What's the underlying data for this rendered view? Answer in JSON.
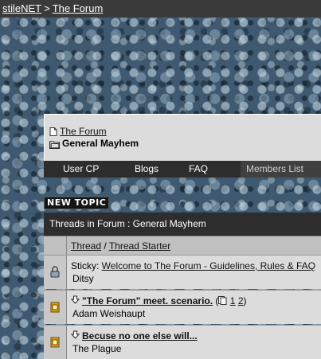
{
  "breadcrumb": {
    "site": "stileNET",
    "separator": ">",
    "current": "The Forum"
  },
  "nav": {
    "forum_link": "The Forum",
    "subforum": "General Mayhem"
  },
  "menu": {
    "items": [
      "User CP",
      "Blogs",
      "FAQ",
      "Members List"
    ]
  },
  "new_topic_label": "NEW TOPIC",
  "threads_header": "Threads in Forum : General Mayhem",
  "columns": {
    "thread": "Thread",
    "separator": " / ",
    "starter": "Thread Starter"
  },
  "threads": [
    {
      "prefix": "Sticky: ",
      "title": "Welcome to The Forum - Guidelines, Rules & FAQ",
      "starter": "Ditsy",
      "icon": "lock-icon"
    },
    {
      "title": "\"The Forum\" meet. scenario.",
      "pages_open": " (",
      "page1": "1",
      "page2": "2",
      "pages_close": ")",
      "starter": "Adam Weishaupt",
      "icon": "folder-icon"
    },
    {
      "title": "Becuse no one else will...",
      "starter": "The Plague",
      "icon": "folder-icon"
    }
  ],
  "colors": {
    "bar": "#2d2d2d",
    "panel": "#dcdcdc",
    "header": "#c0c0c0"
  }
}
